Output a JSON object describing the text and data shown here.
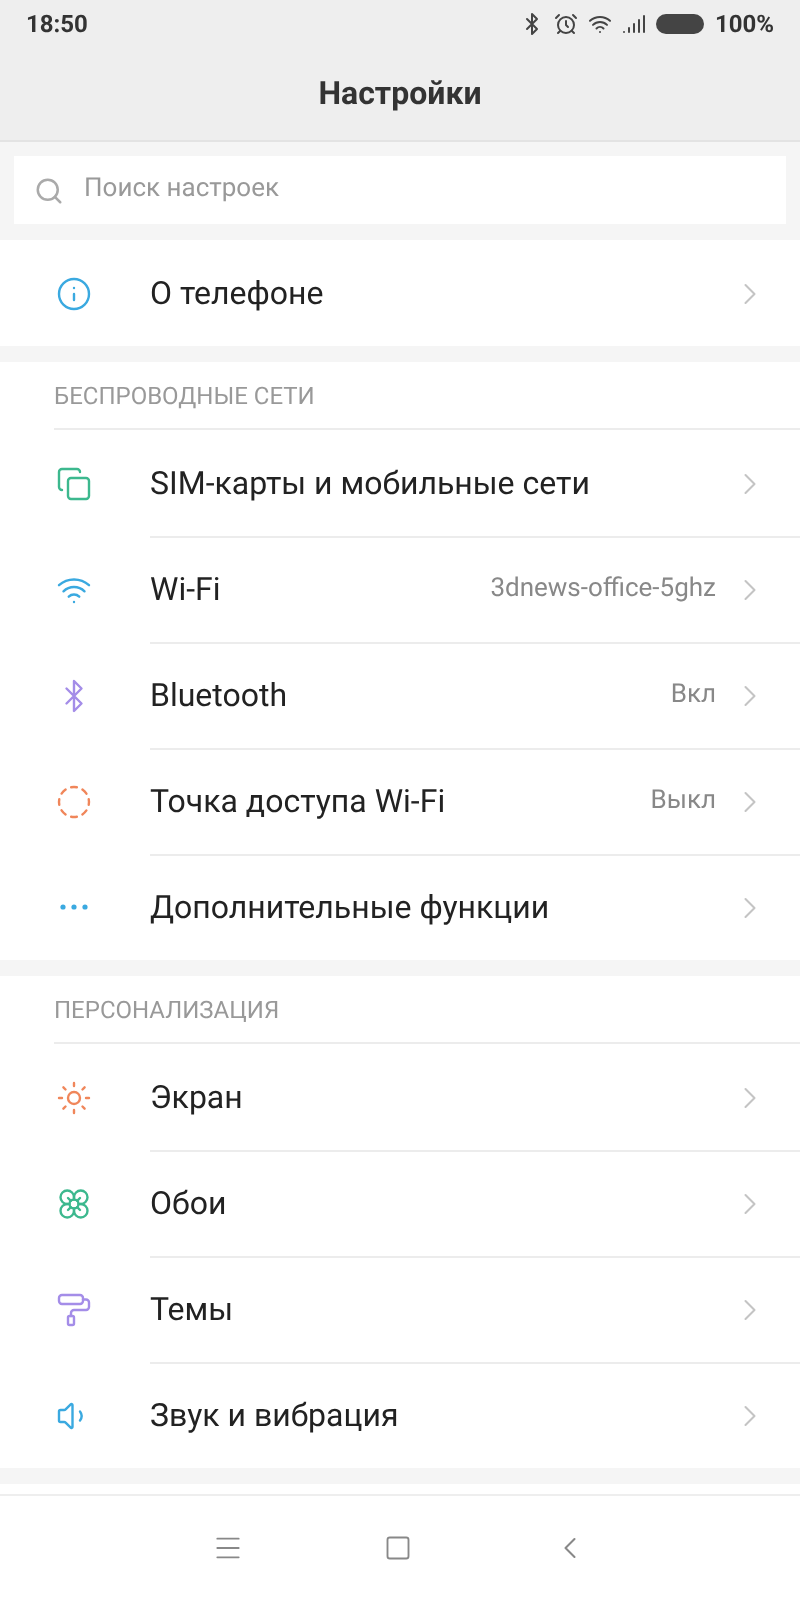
{
  "status_bar": {
    "time": "18:50",
    "battery": "100%"
  },
  "header": {
    "title": "Настройки"
  },
  "search": {
    "placeholder": "Поиск настроек"
  },
  "top_items": [
    {
      "label": "О телефоне"
    }
  ],
  "sections": [
    {
      "title": "БЕСПРОВОДНЫЕ СЕТИ",
      "items": [
        {
          "label": "SIM-карты и мобильные сети"
        },
        {
          "label": "Wi-Fi",
          "value": "3dnews-office-5ghz"
        },
        {
          "label": "Bluetooth",
          "value": "Вкл"
        },
        {
          "label": "Точка доступа Wi-Fi",
          "value": "Выкл"
        },
        {
          "label": "Дополнительные функции"
        }
      ]
    },
    {
      "title": "ПЕРСОНАЛИЗАЦИЯ",
      "items": [
        {
          "label": "Экран"
        },
        {
          "label": "Обои"
        },
        {
          "label": "Темы"
        },
        {
          "label": "Звук и вибрация"
        }
      ]
    }
  ]
}
